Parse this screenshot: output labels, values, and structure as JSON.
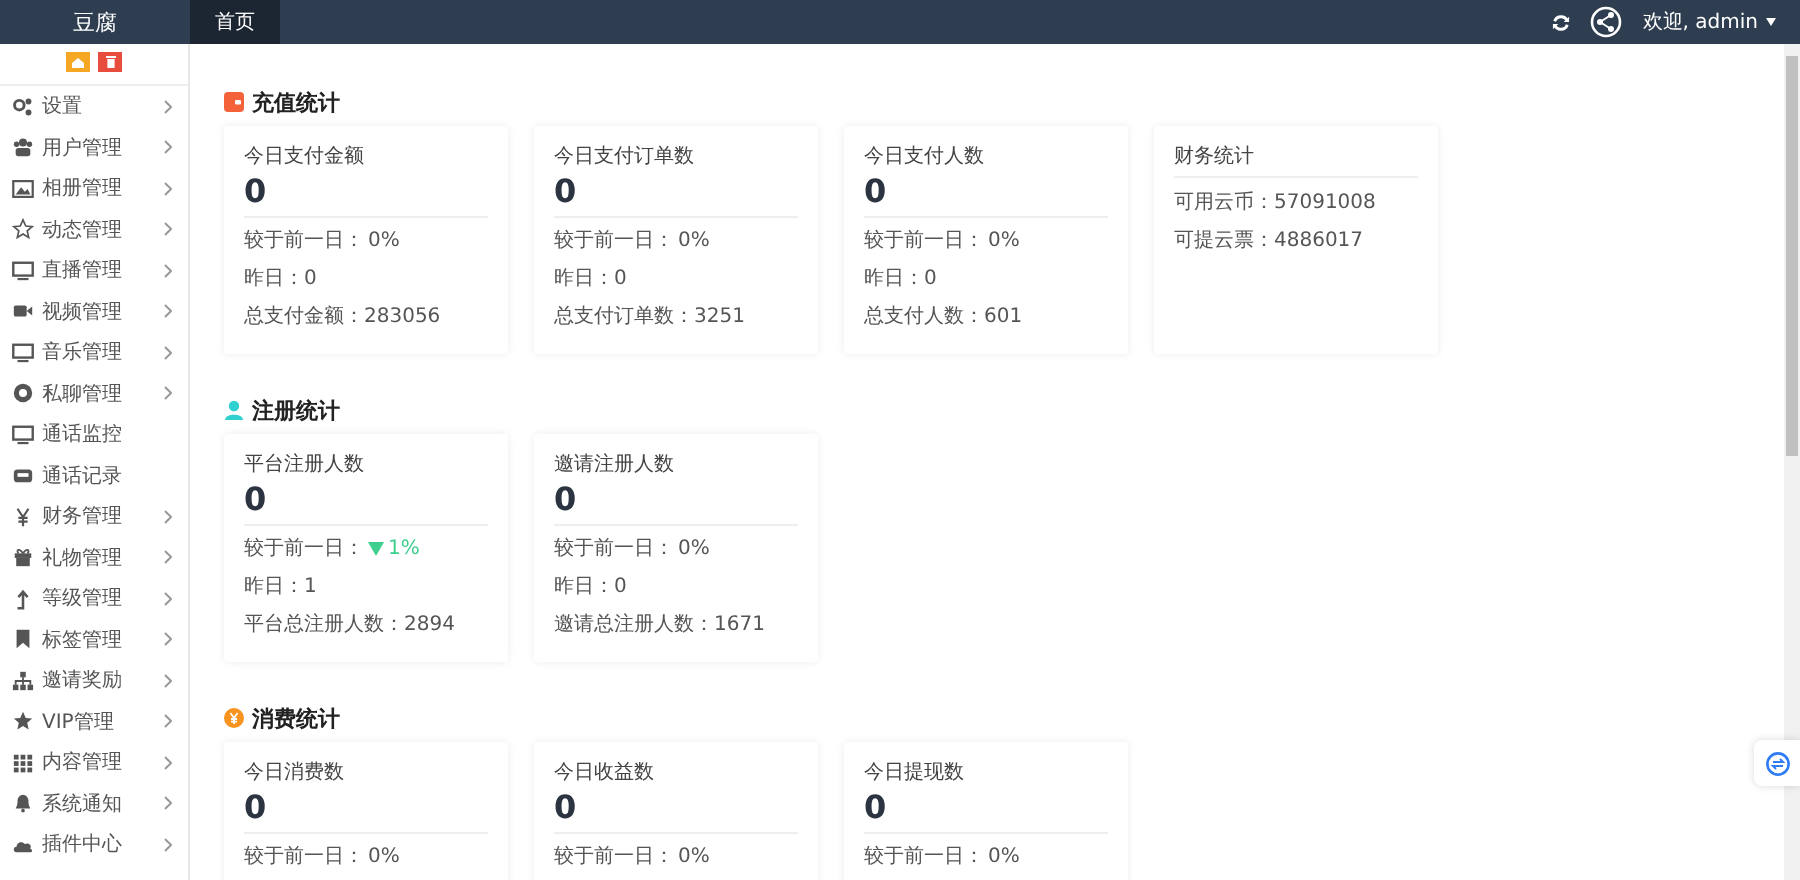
{
  "header": {
    "logo": "豆腐",
    "tabs": [
      {
        "label": "首页",
        "selected": true
      }
    ],
    "user": "欢迎, admin"
  },
  "sidebar": {
    "items": [
      {
        "label": "设置",
        "expandable": true
      },
      {
        "label": "用户管理",
        "expandable": true
      },
      {
        "label": "相册管理",
        "expandable": true
      },
      {
        "label": "动态管理",
        "expandable": true
      },
      {
        "label": "直播管理",
        "expandable": true
      },
      {
        "label": "视频管理",
        "expandable": true
      },
      {
        "label": "音乐管理",
        "expandable": true
      },
      {
        "label": "私聊管理",
        "expandable": true
      },
      {
        "label": "通话监控",
        "expandable": false
      },
      {
        "label": "通话记录",
        "expandable": false
      },
      {
        "label": "财务管理",
        "expandable": true
      },
      {
        "label": "礼物管理",
        "expandable": true
      },
      {
        "label": "等级管理",
        "expandable": true
      },
      {
        "label": "标签管理",
        "expandable": true
      },
      {
        "label": "邀请奖励",
        "expandable": true
      },
      {
        "label": "VIP管理",
        "expandable": true
      },
      {
        "label": "内容管理",
        "expandable": true
      },
      {
        "label": "系统通知",
        "expandable": true
      },
      {
        "label": "插件中心",
        "expandable": true
      }
    ]
  },
  "sections": [
    {
      "title": "充值统计",
      "cards": [
        {
          "kind": "stat",
          "title": "今日支付金额",
          "value": "0",
          "compare": {
            "label": "较于前一日：",
            "value": "0%",
            "decreased": false
          },
          "rows": [
            "昨日：0",
            "总支付金额：283056"
          ]
        },
        {
          "kind": "stat",
          "title": "今日支付订单数",
          "value": "0",
          "compare": {
            "label": "较于前一日：",
            "value": "0%",
            "decreased": false
          },
          "rows": [
            "昨日：0",
            "总支付订单数：3251"
          ]
        },
        {
          "kind": "stat",
          "title": "今日支付人数",
          "value": "0",
          "compare": {
            "label": "较于前一日：",
            "value": "0%",
            "decreased": false
          },
          "rows": [
            "昨日：0",
            "总支付人数：601"
          ]
        },
        {
          "kind": "summary",
          "title": "财务统计",
          "rows": [
            "可用云币：57091008",
            "可提云票：4886017"
          ]
        }
      ]
    },
    {
      "title": "注册统计",
      "cards": [
        {
          "kind": "stat",
          "title": "平台注册人数",
          "value": "0",
          "compare": {
            "label": "较于前一日：",
            "value": "1%",
            "decreased": true
          },
          "rows": [
            "昨日：1",
            "平台总注册人数：2894"
          ]
        },
        {
          "kind": "stat",
          "title": "邀请注册人数",
          "value": "0",
          "compare": {
            "label": "较于前一日：",
            "value": "0%",
            "decreased": false
          },
          "rows": [
            "昨日：0",
            "邀请总注册人数：1671"
          ]
        }
      ]
    },
    {
      "title": "消费统计",
      "cards": [
        {
          "kind": "stat",
          "title": "今日消费数",
          "value": "0",
          "compare": {
            "label": "较于前一日：",
            "value": "0%",
            "decreased": false
          }
        },
        {
          "kind": "stat",
          "title": "今日收益数",
          "value": "0",
          "compare": {
            "label": "较于前一日：",
            "value": "0%",
            "decreased": false
          }
        },
        {
          "kind": "stat",
          "title": "今日提现数",
          "value": "0",
          "compare": {
            "label": "较于前一日：",
            "value": "0%",
            "decreased": false
          }
        }
      ]
    }
  ]
}
